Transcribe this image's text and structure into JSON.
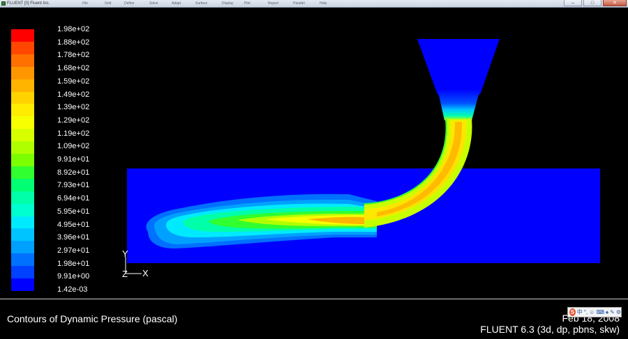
{
  "window": {
    "title": "FLUENT [0] Fluent Inc.",
    "menu_items": [
      "File",
      "Grid",
      "Define",
      "Solve",
      "Adapt",
      "Surface",
      "Display",
      "Plot",
      "Report",
      "Parallel",
      "Help"
    ],
    "controls": {
      "minimize": "–",
      "maximize": "□",
      "close": "✕"
    }
  },
  "legend": {
    "labels": [
      "1.98e+02",
      "1.88e+02",
      "1.78e+02",
      "1.68e+02",
      "1.59e+02",
      "1.49e+02",
      "1.39e+02",
      "1.29e+02",
      "1.19e+02",
      "1.09e+02",
      "9.91e+01",
      "8.92e+01",
      "7.93e+01",
      "6.94e+01",
      "5.95e+01",
      "4.95e+01",
      "3.96e+01",
      "2.97e+01",
      "1.98e+01",
      "9.91e+00",
      "1.42e-03"
    ],
    "colors": [
      "#ff0000",
      "#ff4600",
      "#ff7000",
      "#ff9600",
      "#ffb400",
      "#ffd200",
      "#ffec00",
      "#f8ff00",
      "#d8ff00",
      "#b0ff00",
      "#7cff00",
      "#30ff30",
      "#00ff72",
      "#00ffa8",
      "#00ffd0",
      "#00eaff",
      "#00c4ff",
      "#00a0ff",
      "#0070ff",
      "#0040ff",
      "#0000ff"
    ]
  },
  "axes": {
    "y": "Y",
    "z": "Z",
    "x": "X"
  },
  "caption": {
    "title": "Contours of Dynamic Pressure (pascal)",
    "date": "Feb 18, 2008",
    "version": "FLUENT 6.3 (3d, dp, pbns, skw)"
  },
  "tray": {
    "logo": "S",
    "items": [
      "中",
      "°,",
      "☺",
      "⌨",
      "♠",
      "✎",
      "⚙"
    ]
  }
}
